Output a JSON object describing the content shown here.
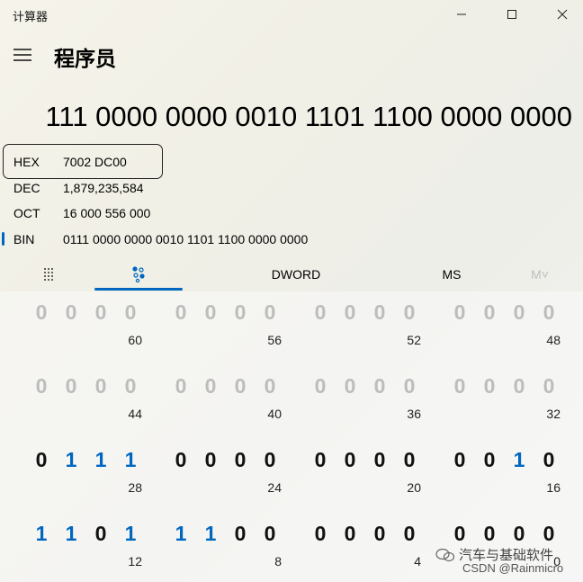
{
  "window": {
    "title": "计算器"
  },
  "header": {
    "mode_title": "程序员"
  },
  "display": {
    "value": "111 0000 0000 0010 1101 1100 0000 0000"
  },
  "radix": {
    "hex": {
      "name": "HEX",
      "value": "7002 DC00"
    },
    "dec": {
      "name": "DEC",
      "value": "1,879,235,584"
    },
    "oct": {
      "name": "OCT",
      "value": "16 000 556 000"
    },
    "bin": {
      "name": "BIN",
      "value": "0111 0000 0000 0010 1101 1100 0000 0000"
    }
  },
  "tabs": {
    "word_size": "DWORD",
    "memory_store": "MS",
    "memory_list": "M˅"
  },
  "bit_rows": [
    {
      "bits": [
        "0",
        "0",
        "0",
        "0",
        "0",
        "0",
        "0",
        "0",
        "0",
        "0",
        "0",
        "0",
        "0",
        "0",
        "0",
        "0"
      ],
      "state": "off",
      "labels": [
        "60",
        "56",
        "52",
        "48"
      ]
    },
    {
      "bits": [
        "0",
        "0",
        "0",
        "0",
        "0",
        "0",
        "0",
        "0",
        "0",
        "0",
        "0",
        "0",
        "0",
        "0",
        "0",
        "0"
      ],
      "state": "off",
      "labels": [
        "44",
        "40",
        "36",
        "32"
      ]
    },
    {
      "bits": [
        "0",
        "1",
        "1",
        "1",
        "0",
        "0",
        "0",
        "0",
        "0",
        "0",
        "0",
        "0",
        "0",
        "0",
        "1",
        "0"
      ],
      "state": "on",
      "labels": [
        "28",
        "24",
        "20",
        "16"
      ]
    },
    {
      "bits": [
        "1",
        "1",
        "0",
        "1",
        "1",
        "1",
        "0",
        "0",
        "0",
        "0",
        "0",
        "0",
        "0",
        "0",
        "0",
        "0"
      ],
      "state": "on",
      "labels": [
        "12",
        "8",
        "4",
        "0"
      ]
    }
  ],
  "watermark": {
    "line1": "汽车与基础软件",
    "line2": "CSDN @Rainmicro"
  },
  "colors": {
    "accent": "#0067c0",
    "disabled_bit": "#bdbdbd"
  }
}
